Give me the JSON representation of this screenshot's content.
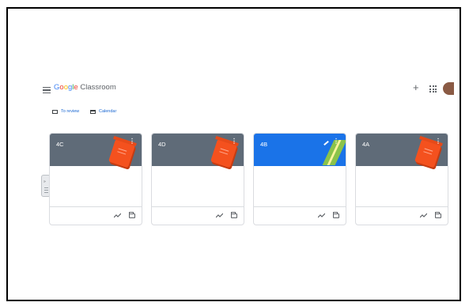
{
  "header": {
    "brand_google": "Google",
    "brand_product": "Classroom"
  },
  "links": {
    "to_review": "To review",
    "calendar": "Calendar"
  },
  "colors": {
    "card_gray": "#5f6b78",
    "card_blue": "#1a73e8",
    "notebook_orange": "#f4511e"
  },
  "icons": [
    "menu-icon",
    "plus-icon",
    "apps-grid-icon",
    "avatar",
    "trend-icon",
    "folder-icon",
    "more-vert-icon",
    "review-icon",
    "calendar-icon"
  ],
  "cards": [
    {
      "title": "4C",
      "color": "#5f6b78",
      "more": "⋮"
    },
    {
      "title": "4D",
      "color": "#5f6b78",
      "more": "⋮"
    },
    {
      "title": "4B",
      "color": "#1a73e8",
      "more": "⋮"
    },
    {
      "title": "4A",
      "color": "#5f6b78",
      "more": "⋮"
    }
  ]
}
